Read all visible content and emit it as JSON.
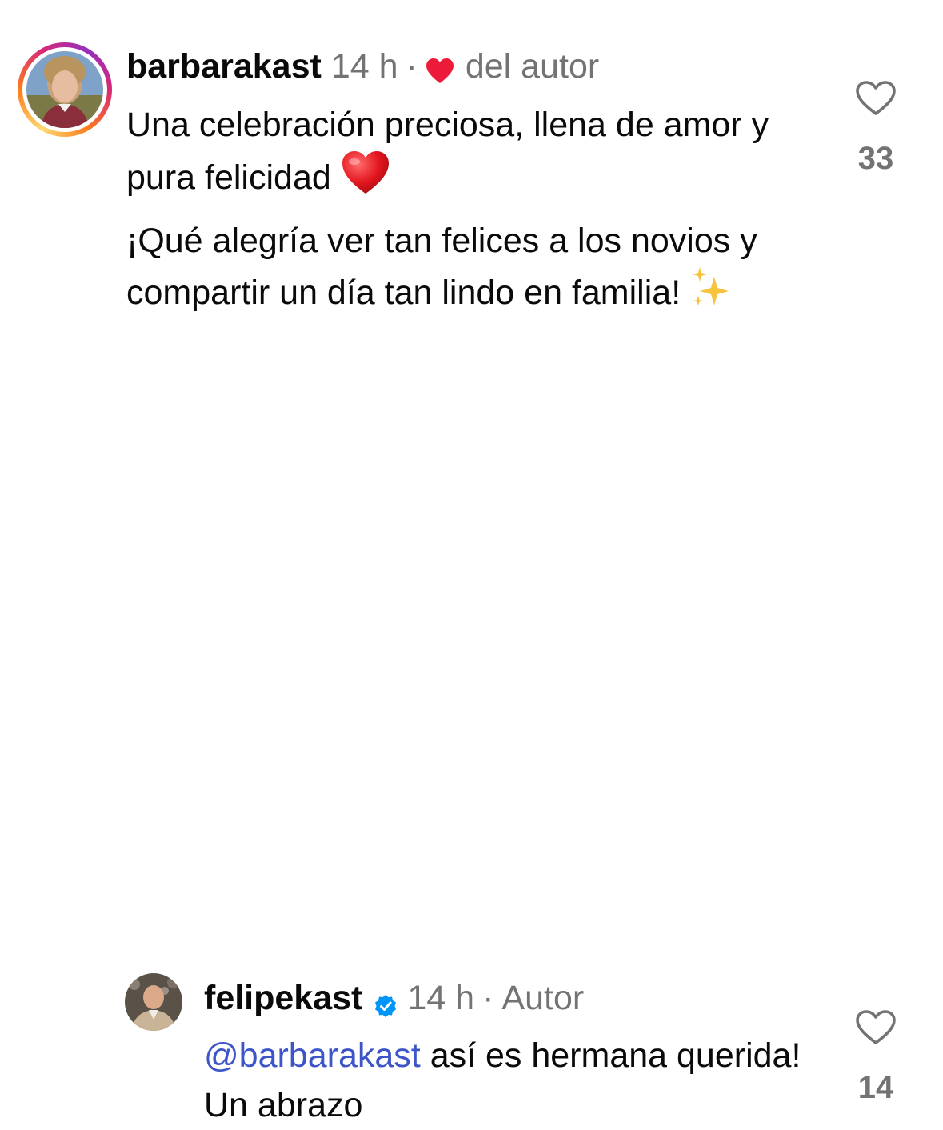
{
  "comments": [
    {
      "username": "barbarakast",
      "time": "14 h",
      "separator": "·",
      "badge_text": "del autor",
      "badge_icon": "red-heart-icon",
      "paragraphs": [
        "Una celebración preciosa, llena de amor y pura felicidad",
        "¡Qué alegría ver tan felices a los novios y compartir un día tan lindo en familia!"
      ],
      "emojis": [
        "red-heart-emoji",
        "sparkles-emoji"
      ],
      "likes": "33",
      "avatar_ring": true
    },
    {
      "username": "felipekast",
      "verified": true,
      "time": "14 h",
      "separator": "·",
      "badge_text": "Autor",
      "mention": "@barbarakast",
      "text": "así es hermana querida! Un abrazo",
      "likes": "14",
      "avatar_ring": false
    }
  ],
  "colors": {
    "text": "#0a0a0a",
    "meta": "#737373",
    "mention": "#3d55c9",
    "heart": "#ed1b3a",
    "verified": "#0095f6"
  }
}
